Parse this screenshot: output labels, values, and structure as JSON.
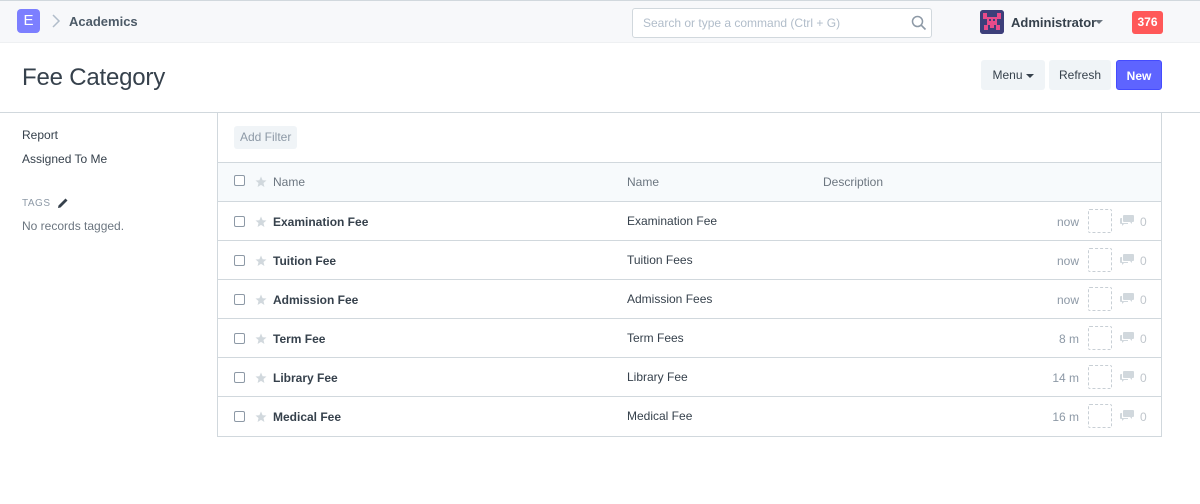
{
  "navbar": {
    "logo_letter": "E",
    "breadcrumb": "Academics",
    "search_placeholder": "Search or type a command (Ctrl + G)",
    "user_name": "Administrator",
    "notification_count": "376"
  },
  "page": {
    "title": "Fee Category",
    "buttons": {
      "menu": "Menu",
      "refresh": "Refresh",
      "new": "New"
    }
  },
  "sidebar": {
    "links": [
      "Report",
      "Assigned To Me"
    ],
    "tags_label": "TAGS",
    "no_tags_text": "No records tagged."
  },
  "list": {
    "add_filter": "Add Filter",
    "columns": [
      "Name",
      "Name",
      "Description"
    ],
    "rows": [
      {
        "title": "Examination Fee",
        "name": "Examination Fee",
        "description": "",
        "modified": "now",
        "comments": "0"
      },
      {
        "title": "Tuition Fee",
        "name": "Tuition Fees",
        "description": "",
        "modified": "now",
        "comments": "0"
      },
      {
        "title": "Admission Fee",
        "name": "Admission Fees",
        "description": "",
        "modified": "now",
        "comments": "0"
      },
      {
        "title": "Term Fee",
        "name": "Term Fees",
        "description": "",
        "modified": "8 m",
        "comments": "0"
      },
      {
        "title": "Library Fee",
        "name": "Library Fee",
        "description": "",
        "modified": "14 m",
        "comments": "0"
      },
      {
        "title": "Medical Fee",
        "name": "Medical Fee",
        "description": "",
        "modified": "16 m",
        "comments": "0"
      }
    ]
  },
  "colors": {
    "primary": "#5e64ff",
    "logo": "#7c7fff",
    "badge": "#ff5858"
  }
}
